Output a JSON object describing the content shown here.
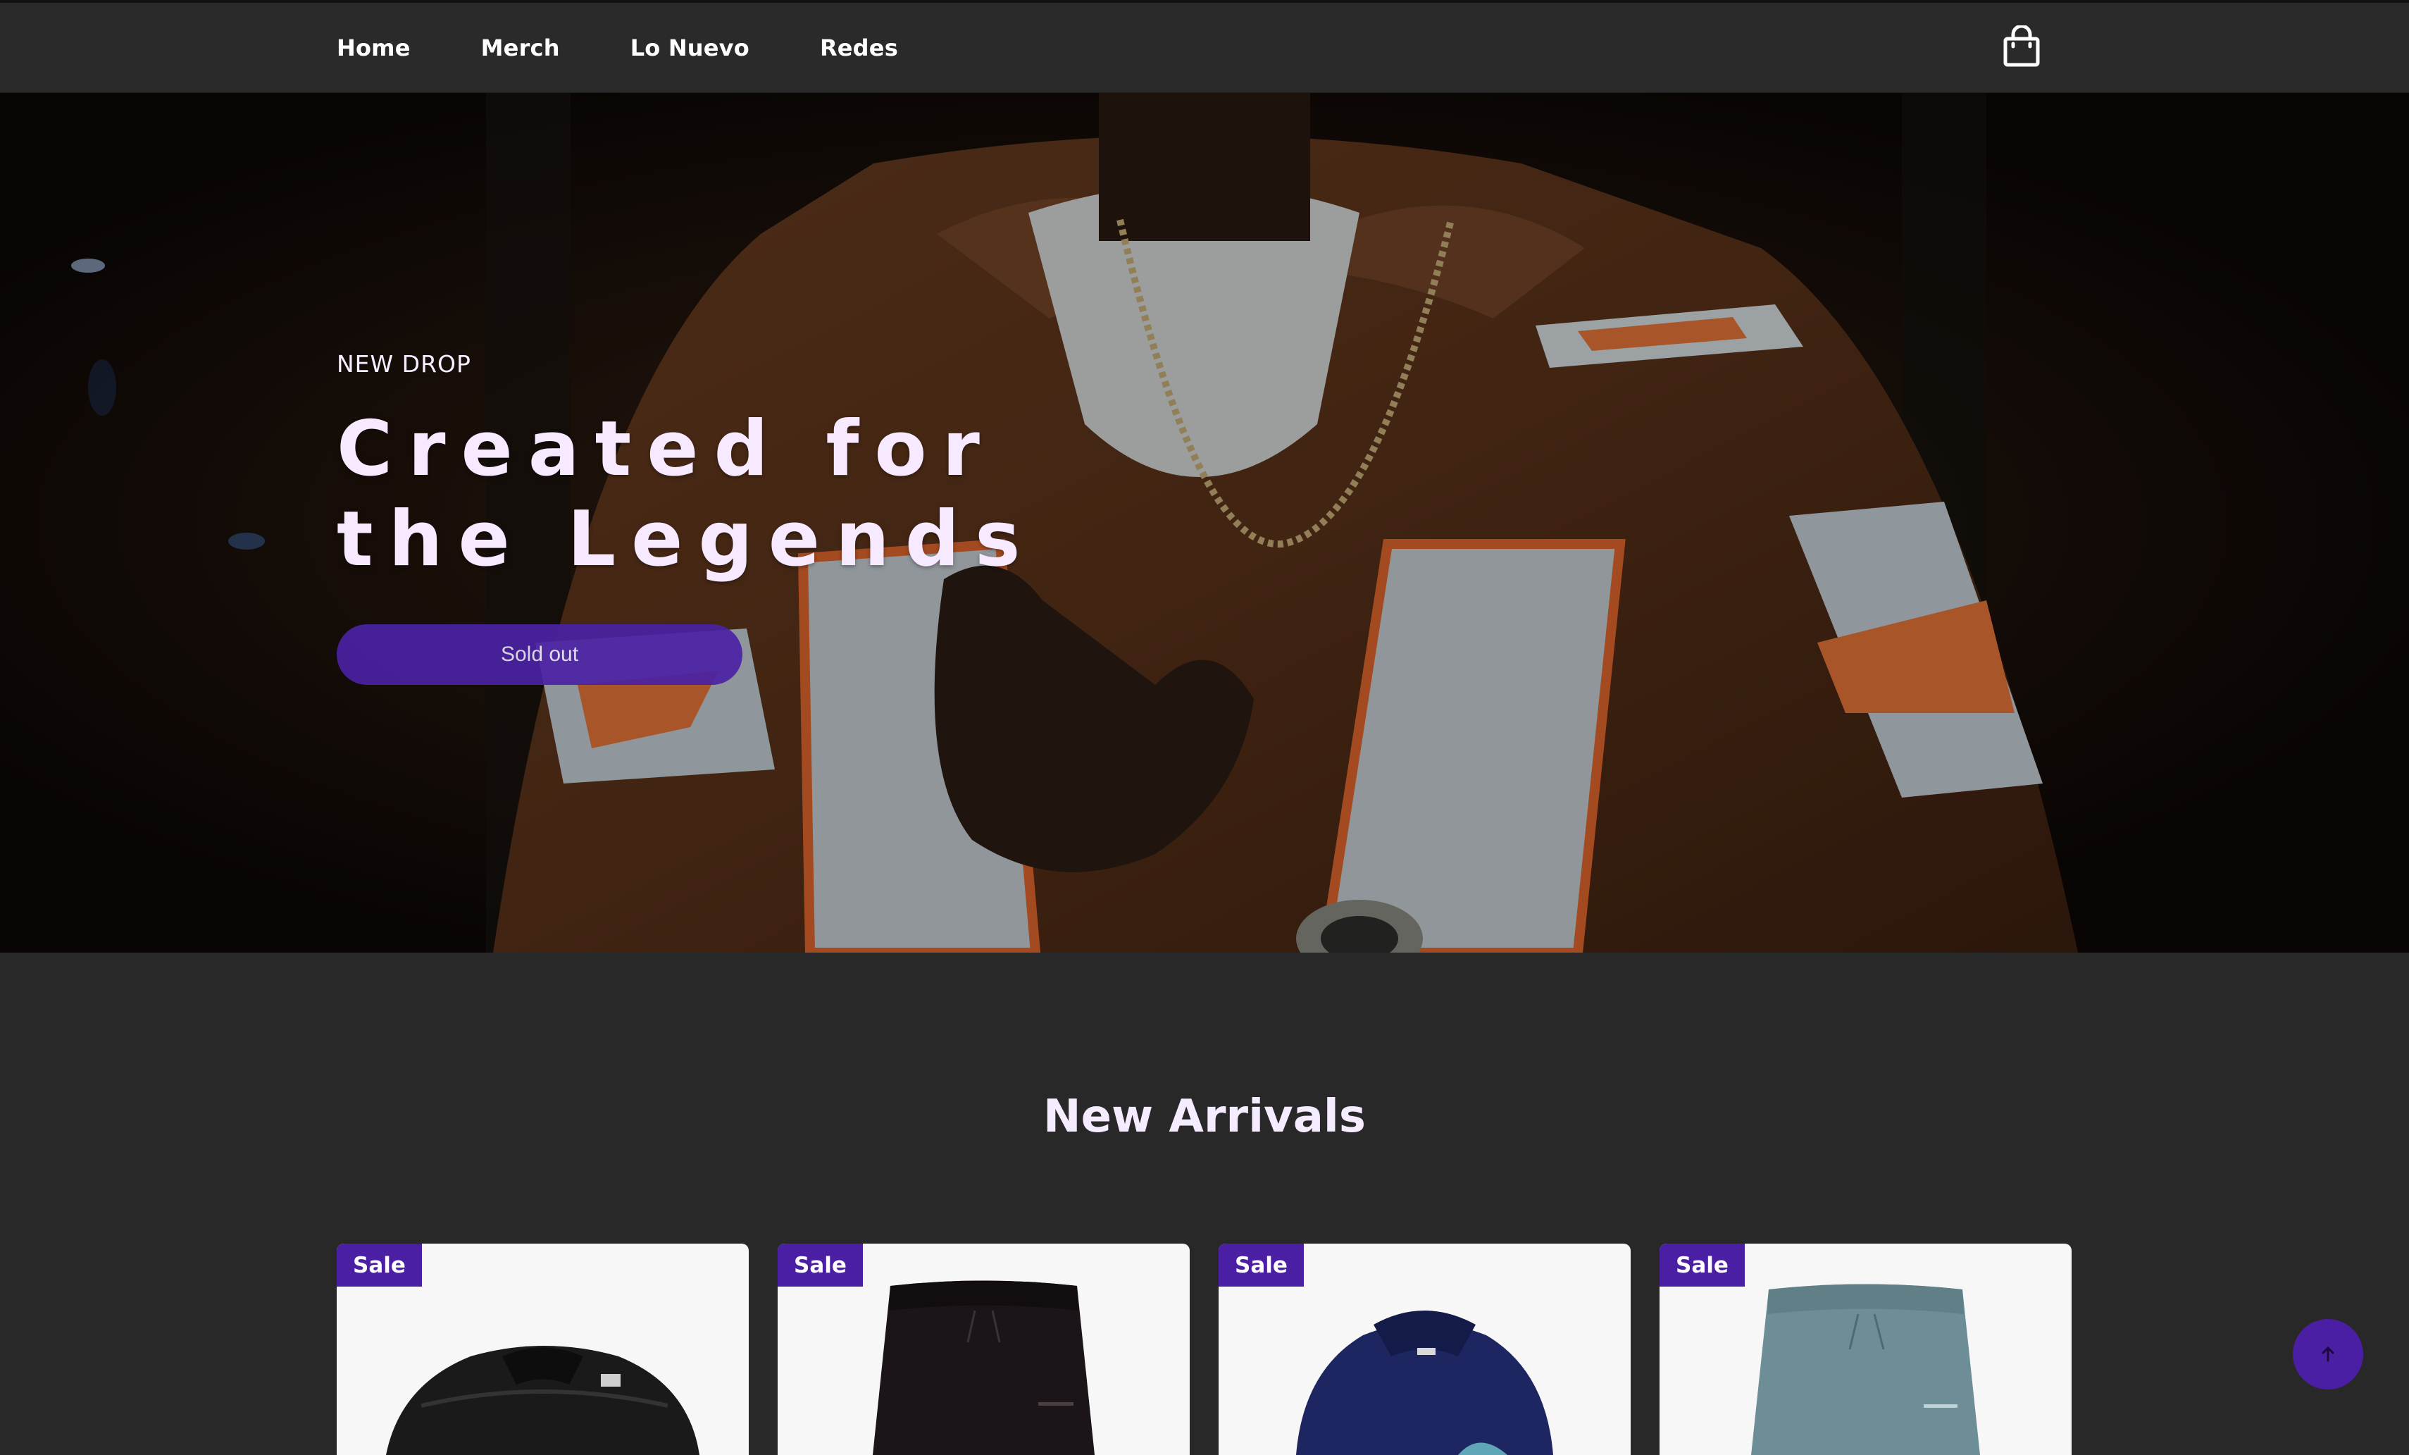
{
  "nav": {
    "links": [
      "Home",
      "Merch",
      "Lo Nuevo",
      "Redes"
    ],
    "cart_icon": "shopping-bag-icon"
  },
  "hero": {
    "eyebrow": "NEW DROP",
    "title": "Created for the Legends",
    "button_label": "Sold out"
  },
  "new_arrivals": {
    "title": "New Arrivals",
    "products": [
      {
        "badge": "Sale",
        "image": "black puffer jacket"
      },
      {
        "badge": "Sale",
        "image": "black sweatpants"
      },
      {
        "badge": "Sale",
        "image": "navy hoodie"
      },
      {
        "badge": "Sale",
        "image": "teal sweatpants"
      }
    ]
  },
  "scroll_top": {
    "icon": "arrow-up-icon"
  },
  "colors": {
    "background": "#292829",
    "navbar": "#2a2a2b",
    "accent": "#4a1fa3",
    "title_text": "#f6ecff"
  }
}
